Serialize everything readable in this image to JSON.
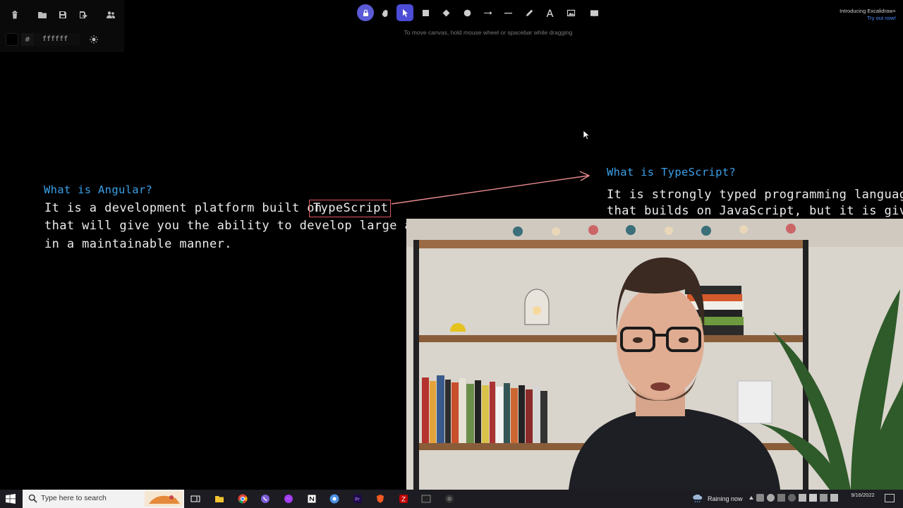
{
  "app": {
    "name": "Excalidraw",
    "theme": "dark"
  },
  "menu": {
    "items": [
      {
        "name": "clear-canvas",
        "icon": "trash-icon"
      },
      {
        "name": "open",
        "icon": "folder-open-icon"
      },
      {
        "name": "save",
        "icon": "save-icon"
      },
      {
        "name": "export",
        "icon": "export-icon"
      },
      {
        "name": "collaborate",
        "icon": "users-icon"
      }
    ],
    "background_color": {
      "hash": "#",
      "value": "ffffff"
    }
  },
  "toolbar": {
    "tools": [
      {
        "name": "lock",
        "icon": "lock-icon"
      },
      {
        "name": "hand",
        "icon": "hand-icon"
      },
      {
        "name": "selection",
        "icon": "cursor-icon",
        "active": true
      },
      {
        "name": "rectangle",
        "icon": "rectangle-icon"
      },
      {
        "name": "diamond",
        "icon": "diamond-icon"
      },
      {
        "name": "ellipse",
        "icon": "ellipse-icon"
      },
      {
        "name": "arrow",
        "icon": "arrow-icon"
      },
      {
        "name": "line",
        "icon": "line-icon"
      },
      {
        "name": "draw",
        "icon": "pencil-icon"
      },
      {
        "name": "text",
        "icon": "text-icon"
      },
      {
        "name": "image",
        "icon": "image-icon"
      },
      {
        "name": "library",
        "icon": "library-icon"
      }
    ],
    "hint": "To move canvas, hold mouse wheel or spacebar while dragging",
    "accent": "#4c4cd6"
  },
  "promo": {
    "line1": "Introducing Excalidraw+",
    "line2": "Try out now!"
  },
  "canvas": {
    "angular": {
      "title": "What is Angular?",
      "line1_before": "It is a development platform built on ",
      "highlight": "TypeScript",
      "line2": "that will give you the ability to develop large applic",
      "line3": "in a maintainable manner."
    },
    "typescript": {
      "title": "What is TypeScript?",
      "line1": "It is strongly typed programming language",
      "line2": "that builds on JavaScript, but it is giving"
    },
    "colors": {
      "title": "#3aa0e8",
      "text": "#ececec",
      "highlight": "#e2555c"
    }
  },
  "taskbar": {
    "search_placeholder": "Type here to search",
    "apps": [
      "task-view",
      "file-explorer",
      "chrome",
      "viber",
      "messenger",
      "notion",
      "chrome-alt",
      "premiere",
      "brave",
      "filezilla",
      "terminal",
      "obs"
    ],
    "weather": "Raining now",
    "clock": {
      "time": "9/16/2022",
      "date": ""
    }
  }
}
